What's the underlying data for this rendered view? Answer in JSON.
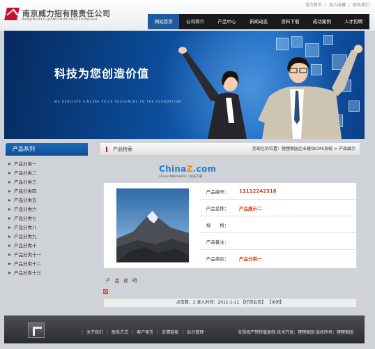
{
  "header": {
    "company_cn": "南京威力招有限责任公司",
    "company_en": "NANJINGWEILIJIANGYOUXIANZEERONGSHI",
    "top_links": [
      "设为首页",
      "加入收藏",
      "联系我们"
    ],
    "nav": [
      "网站首页",
      "公司简介",
      "产品中心",
      "新闻动态",
      "资料下载",
      "成功案例",
      "人才招聘"
    ],
    "active_nav_index": 0
  },
  "banner": {
    "slogan": "科技为您创造价值",
    "tagline": "WE DEDICATE SINCERE PRICE RESOURCES TO THE FOUNDATION"
  },
  "sidebar": {
    "title": "产品系列",
    "items": [
      "产品分类一",
      "产品分类二",
      "产品分类三",
      "产品分类四",
      "产品分类五",
      "产品分类六",
      "产品分类七",
      "产品分类八",
      "产品分类九",
      "产品分类十",
      "产品分类十一",
      "产品分类十二",
      "产品分类十三"
    ]
  },
  "main": {
    "section_title": "产品检索",
    "breadcrumb": "您现在的位置：狸狸家园企业建站CMS系统 > 产品展示",
    "watermark": {
      "brand_blue": "China",
      "brand_orange": "Z",
      "brand_tail": ".com",
      "sub": "China Webmaster | 站长下载"
    },
    "fields": [
      {
        "label": "产品编号：",
        "value": "11112242316",
        "style": "big"
      },
      {
        "label": "产品名称：",
        "value": "产品展示二",
        "style": "red"
      },
      {
        "label": "规　　格：",
        "value": "",
        "style": "plain"
      },
      {
        "label": "产品备注：",
        "value": "",
        "style": "plain"
      },
      {
        "label": "产品类别：",
        "value": "产品分类一",
        "style": "red"
      }
    ],
    "description_label": "产 品 说 明",
    "footer_text": "点击数：2 录入时间：2011-1-11 【打印此页】 【关闭】"
  },
  "footer": {
    "links": [
      "关于我们",
      "联系方式",
      "客户留言",
      "友情链接",
      "后台管理"
    ],
    "copyright": "未授权严禁转载复制 技术开发：狸狸家园 版权所有：狸狸家园"
  },
  "colors": {
    "brand_red": "#c8102e",
    "nav_active": "#1e5a9c",
    "accent_orange": "#d4400e"
  }
}
